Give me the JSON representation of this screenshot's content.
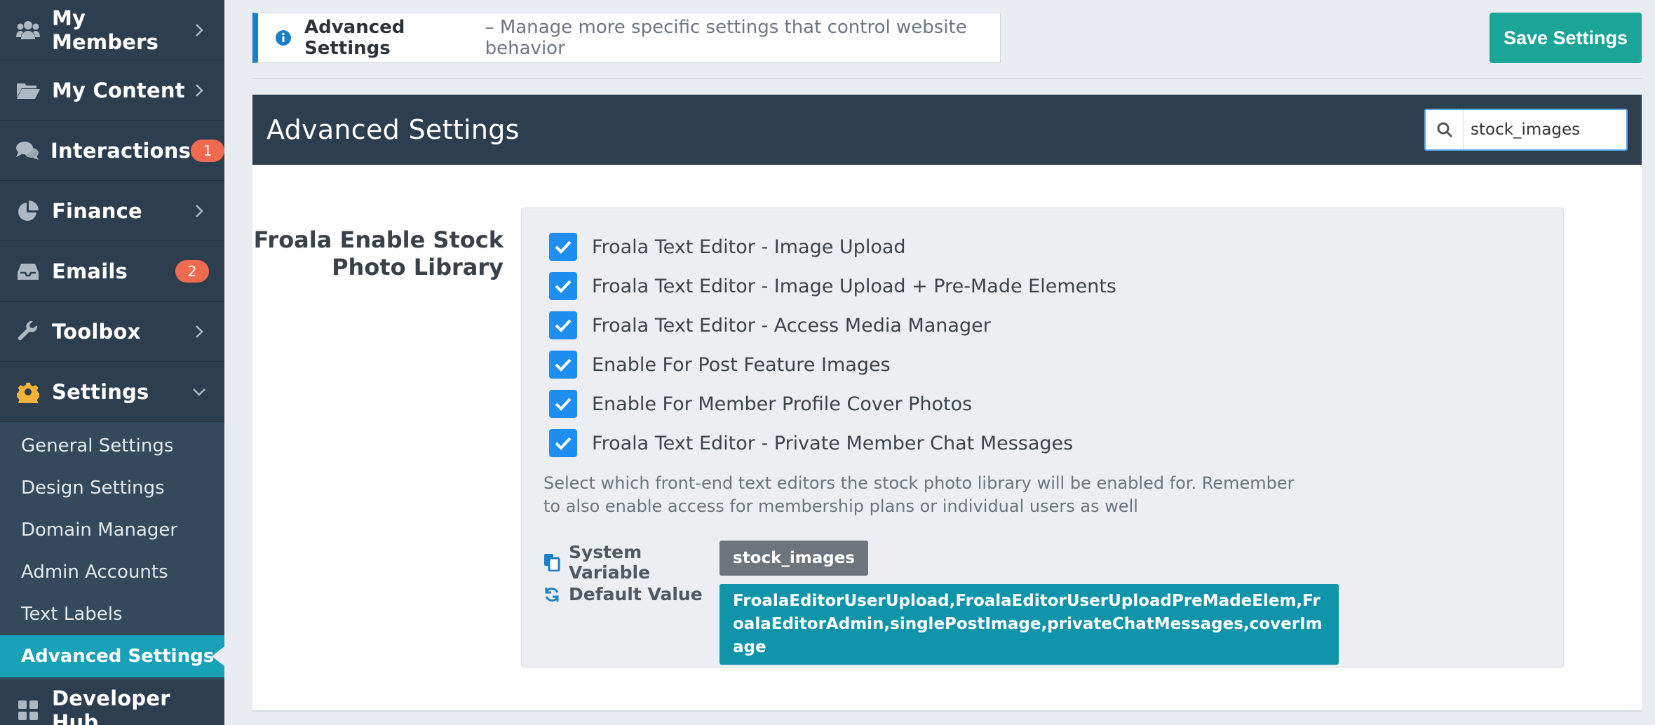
{
  "sidebar": {
    "items": [
      {
        "label": "My Members",
        "icon": "users-icon"
      },
      {
        "label": "My Content",
        "icon": "folder-open-icon"
      },
      {
        "label": "Interactions",
        "icon": "comments-icon",
        "badge": "1"
      },
      {
        "label": "Finance",
        "icon": "pie-chart-icon"
      },
      {
        "label": "Emails",
        "icon": "inbox-icon",
        "badge": "2"
      },
      {
        "label": "Toolbox",
        "icon": "wrench-icon"
      },
      {
        "label": "Settings",
        "icon": "gear-icon"
      }
    ],
    "settings_submenu": [
      "General Settings",
      "Design Settings",
      "Domain Manager",
      "Admin Accounts",
      "Text Labels",
      "Advanced Settings"
    ],
    "partial_item": "Developer Hub"
  },
  "alert": {
    "title": "Advanced Settings",
    "description": "– Manage more specific settings that control website behavior"
  },
  "save_button": "Save Settings",
  "panel": {
    "title": "Advanced Settings",
    "search_value": "stock_images"
  },
  "setting": {
    "label": "Froala Enable Stock Photo Library",
    "options": [
      "Froala Text Editor - Image Upload",
      "Froala Text Editor - Image Upload + Pre-Made Elements",
      "Froala Text Editor - Access Media Manager",
      "Enable For Post Feature Images",
      "Enable For Member Profile Cover Photos",
      "Froala Text Editor - Private Member Chat Messages"
    ],
    "help_text": "Select which front-end text editors the stock photo library will be enabled for. Remember to also enable access for membership plans or individual users as well",
    "system_variable_label": "System Variable",
    "system_variable": "stock_images",
    "default_value_label": "Default Value",
    "default_value": "FroalaEditorUserUpload,FroalaEditorUserUploadPreMadeElem,FroalaEditorAdmin,singlePostImage,privateChatMessages,coverImage"
  },
  "colors": {
    "sidebar_bg": "#2d3e4e",
    "accent_teal": "#1ba596",
    "active_sub": "#18a2b8",
    "checkbox_blue": "#1e8ef0",
    "badge_orange": "#ef6a4e"
  }
}
